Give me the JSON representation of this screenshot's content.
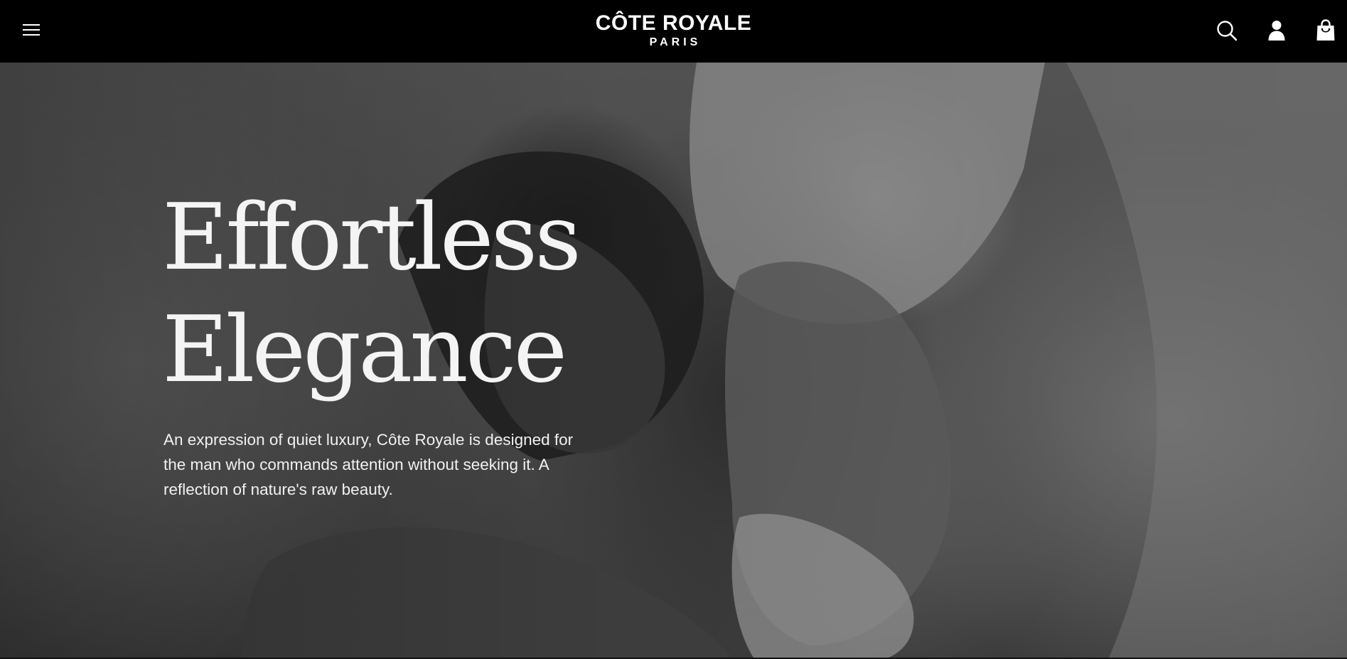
{
  "header": {
    "menu_icon": "hamburger-menu-icon",
    "brand": {
      "name": "CÔTE ROYALE",
      "city": "PARIS"
    },
    "actions": [
      {
        "icon": "search-icon"
      },
      {
        "icon": "user-icon"
      },
      {
        "icon": "shopping-bag-icon"
      }
    ]
  },
  "hero": {
    "title_line_1": "Effortless",
    "title_line_2": "Elegance",
    "description": "An expression of quiet luxury, Côte Royale is designed for the man who commands attention without seeking it. A reflection of nature's raw beauty.",
    "image_style": "black-and-white photo"
  },
  "colors": {
    "header_bg": "#000000",
    "text": "#ffffff"
  }
}
